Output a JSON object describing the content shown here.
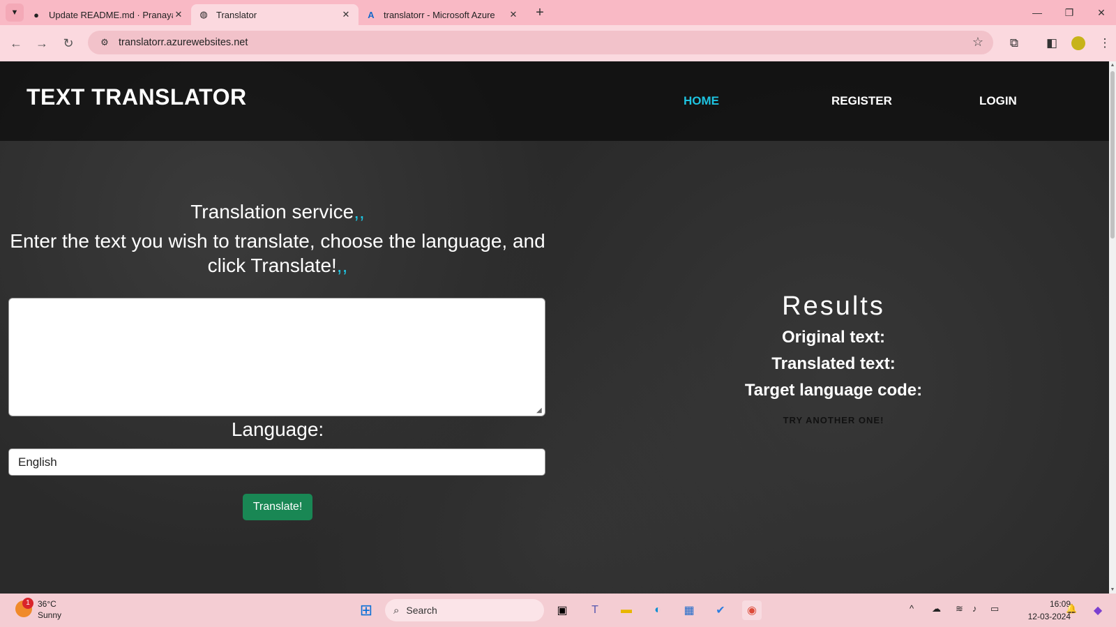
{
  "browser": {
    "tabs": [
      {
        "title": "Update README.md · Pranayac",
        "icon": "github-icon"
      },
      {
        "title": "Translator",
        "icon": "globe-icon"
      },
      {
        "title": "translatorr - Microsoft Azure",
        "icon": "azure-icon"
      }
    ],
    "url": "translatorr.azurewebsites.net"
  },
  "site": {
    "brand": "TEXT TRANSLATOR",
    "nav": {
      "home": "HOME",
      "register": "REGISTER",
      "login": "LOGIN"
    },
    "service_title": "Translation service",
    "service_desc": "Enter the text you wish to translate, choose the language, and click Translate!",
    "accent_marks": ",,",
    "textarea_value": "",
    "language_label": "Language:",
    "language_selected": "English",
    "translate_button": "Translate!",
    "results_title": "Results",
    "original_text_label": "Original text:",
    "translated_text_label": "Translated text:",
    "target_code_label": "Target language code:",
    "try_another": "TRY ANOTHER ONE!",
    "accent_color": "#1ec3e0",
    "button_color": "#198754"
  },
  "taskbar": {
    "weather_temp": "36°C",
    "weather_cond": "Sunny",
    "weather_badge": "1",
    "search_placeholder": "Search",
    "time": "16:09",
    "date": "12-03-2024"
  }
}
